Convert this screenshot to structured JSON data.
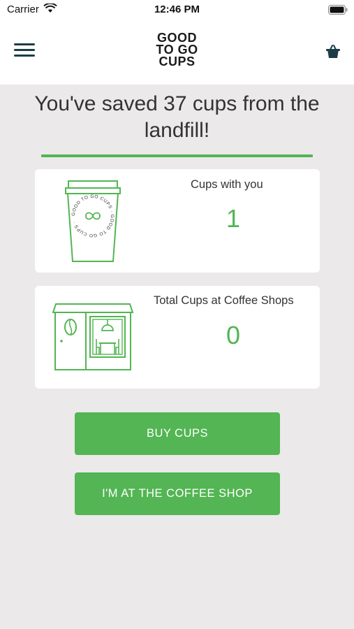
{
  "status": {
    "carrier": "Carrier",
    "time": "12:46 PM"
  },
  "header": {
    "logo_lines": [
      "GOOD",
      "TO GO",
      "CUPS"
    ],
    "menu_icon": "hamburger-menu-icon",
    "cart_icon": "basket-icon"
  },
  "main": {
    "headline": "You've saved 37 cups from the landfill!",
    "cards": [
      {
        "label": "Cups with you",
        "value": "1",
        "icon": "cup-icon",
        "cup_ring_text": "GOOD TO GO CUPS · GOOD TO GO CUPS ·"
      },
      {
        "label": "Total Cups at Coffee Shops",
        "value": "0",
        "icon": "coffee-shop-icon"
      }
    ],
    "buttons": {
      "buy": "BUY CUPS",
      "at_shop": "I'M AT THE COFFEE SHOP"
    }
  },
  "colors": {
    "accent": "#53b553",
    "background": "#ebe9ea",
    "nav_icon": "#1d3d46"
  }
}
